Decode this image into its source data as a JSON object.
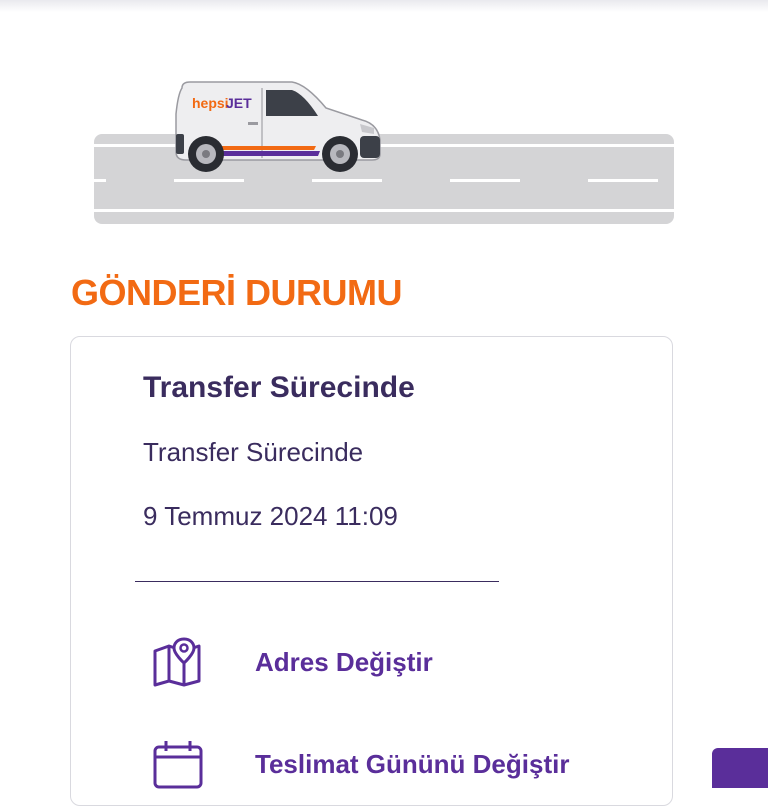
{
  "hero": {
    "brand_prefix": "hepsi",
    "brand_suffix": "JET",
    "colors": {
      "orange": "#f26a13",
      "purple": "#5a2e9a",
      "road": "#d4d4d6"
    }
  },
  "section_title": "GÖNDERİ DURUMU",
  "status": {
    "heading": "Transfer Sürecinde",
    "description": "Transfer Sürecinde",
    "datetime": "9 Temmuz 2024 11:09"
  },
  "actions": [
    {
      "icon": "map-pin-icon",
      "label": "Adres Değiştir"
    },
    {
      "icon": "calendar-icon",
      "label": "Teslimat Gününü Değiştir"
    }
  ],
  "colors": {
    "title_orange": "#f26a13",
    "text_dark_purple": "#3a2c5e",
    "action_purple": "#5a2e9a"
  }
}
